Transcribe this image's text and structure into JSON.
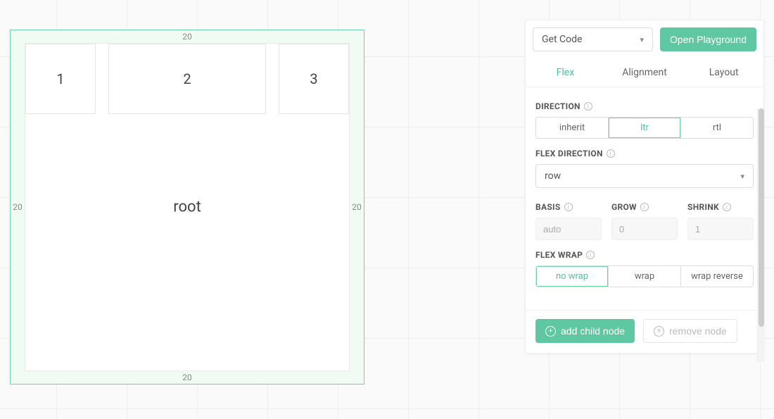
{
  "canvas": {
    "root_label": "root",
    "padding": {
      "top": "20",
      "right": "20",
      "bottom": "20",
      "left": "20"
    },
    "children": [
      {
        "label": "1"
      },
      {
        "label": "2"
      },
      {
        "label": "3"
      }
    ]
  },
  "panel": {
    "get_code_label": "Get Code",
    "open_playground_label": "Open Playground",
    "tabs": {
      "flex": "Flex",
      "alignment": "Alignment",
      "layout": "Layout"
    },
    "sections": {
      "direction": {
        "label": "DIRECTION",
        "options": {
          "inherit": "inherit",
          "ltr": "ltr",
          "rtl": "rtl"
        },
        "active": "ltr"
      },
      "flex_direction": {
        "label": "FLEX DIRECTION",
        "value": "row"
      },
      "basis": {
        "label": "BASIS",
        "placeholder": "auto"
      },
      "grow": {
        "label": "GROW",
        "placeholder": "0"
      },
      "shrink": {
        "label": "SHRINK",
        "placeholder": "1"
      },
      "flex_wrap": {
        "label": "FLEX WRAP",
        "options": {
          "nowrap": "no wrap",
          "wrap": "wrap",
          "wrap_reverse": "wrap reverse"
        },
        "active": "nowrap"
      }
    },
    "footer": {
      "add_label": "add child node",
      "remove_label": "remove node"
    }
  }
}
